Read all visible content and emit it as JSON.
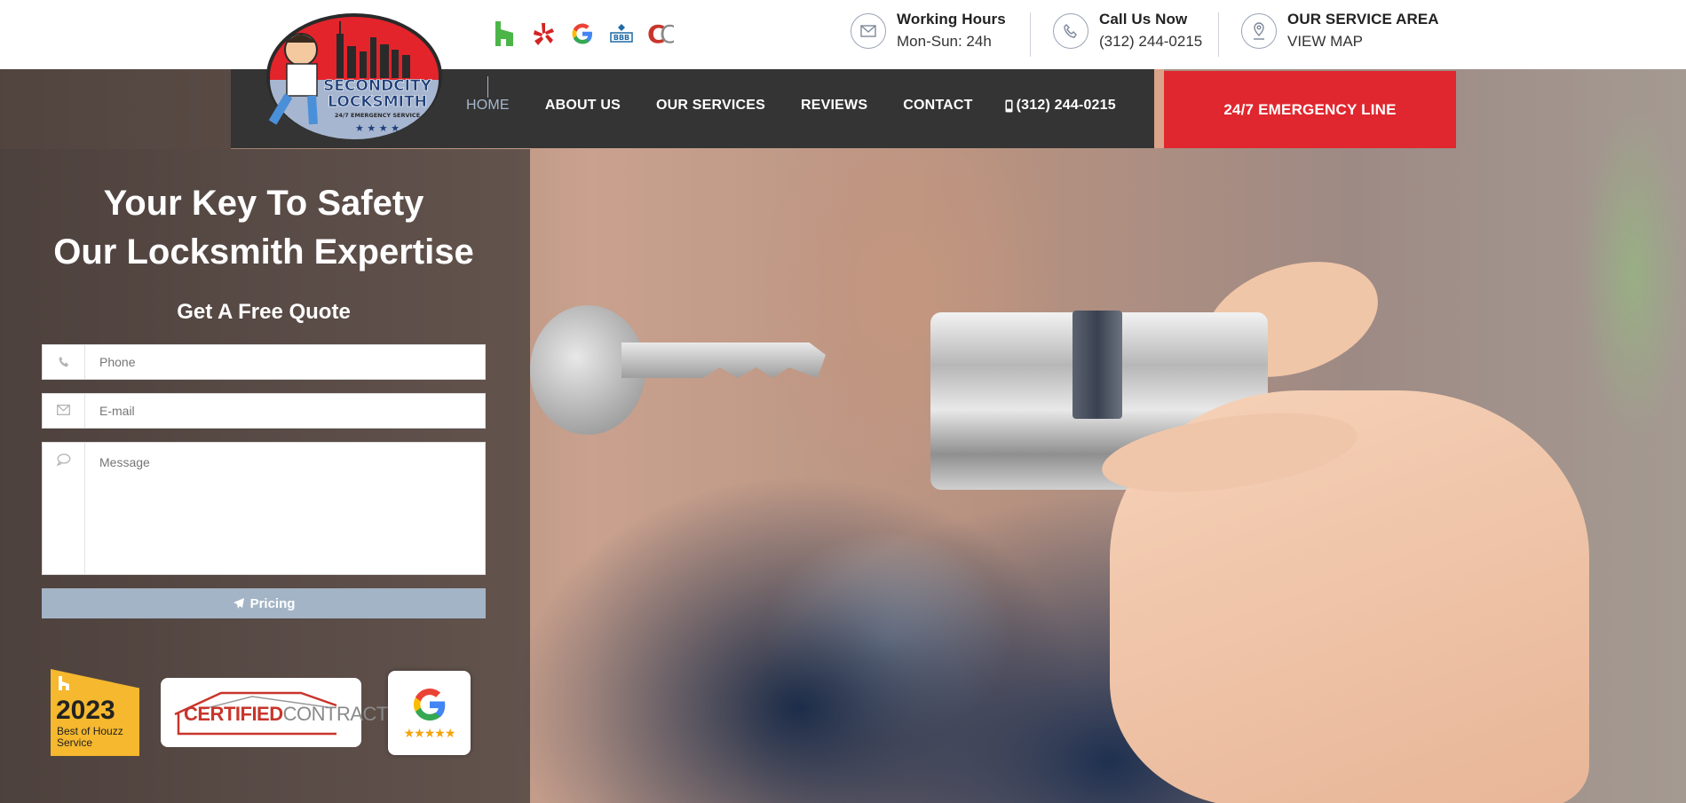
{
  "brand": {
    "logo_alt": "SecondCity Locksmith 24/7 Emergency Service",
    "logo_line1": "SECONDCITY",
    "logo_line2": "LOCKSMITH",
    "logo_line3": "24/7 EMERGENCY SERVICE"
  },
  "social_icons": [
    "houzz-icon",
    "yelp-icon",
    "google-icon",
    "bbb-icon",
    "certified-contractors-icon"
  ],
  "header_info": {
    "hours": {
      "title": "Working Hours",
      "value": "Mon-Sun: 24h",
      "icon": "envelope-icon"
    },
    "call": {
      "title": "Call Us Now",
      "value": "(312) 244-0215",
      "icon": "phone-icon"
    },
    "area": {
      "title": "OUR SERVICE AREA",
      "value": "VIEW MAP",
      "icon": "map-pin-icon"
    }
  },
  "nav": {
    "items": [
      "HOME",
      "ABOUT US",
      "OUR SERVICES",
      "REVIEWS",
      "CONTACT"
    ],
    "phone": "(312) 244-0215",
    "emergency": "24/7 EMERGENCY LINE",
    "active": "HOME"
  },
  "hero": {
    "headline_line1": "Your Key To Safety",
    "headline_line2": "Our Locksmith Expertise",
    "form_title": "Get A Free Quote",
    "phone_placeholder": "Phone",
    "email_placeholder": "E-mail",
    "message_placeholder": "Message",
    "submit_label": "Pricing"
  },
  "badges": {
    "houzz_year": "2023",
    "houzz_line1": "Best of Houzz",
    "houzz_line2": "Service",
    "certified_a": "CERTIFIED",
    "certified_b": "CONTRACTORS",
    "google_stars": "★★★★★"
  },
  "colors": {
    "accent_red": "#e0262e",
    "nav_bg": "#343434",
    "button_blue": "#a3b4c6",
    "active_nav": "#a8b7cc"
  }
}
